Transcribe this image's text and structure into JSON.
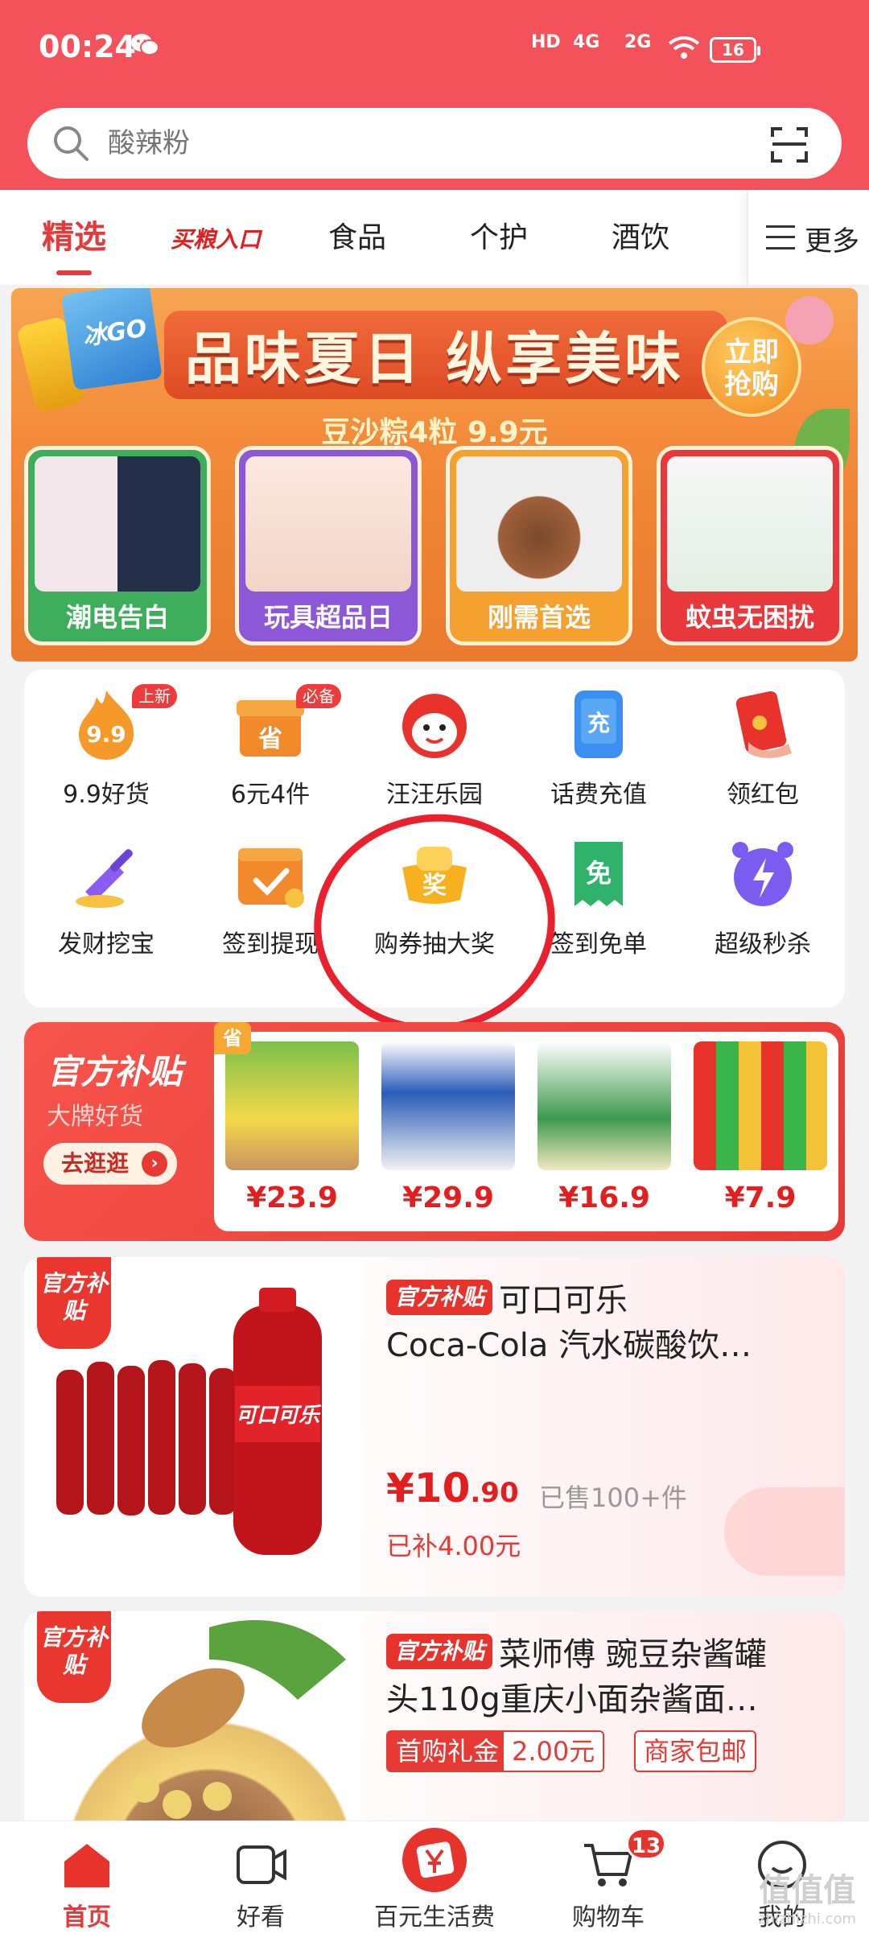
{
  "status_bar": {
    "time": "00:24",
    "hd": "HD",
    "net1": "4G",
    "net2": "2G",
    "battery": "16"
  },
  "search": {
    "placeholder": "酸辣粉"
  },
  "tabs": [
    {
      "label": "精选",
      "active": true
    },
    {
      "label": "买粮入口",
      "special": true
    },
    {
      "label": "食品"
    },
    {
      "label": "个护"
    },
    {
      "label": "酒饮"
    }
  ],
  "more_label": "更多",
  "banner": {
    "headline": "品味夏日 纵享美味",
    "sub": "豆沙粽4粒 9.9元",
    "buy_line1": "立即",
    "buy_line2": "抢购",
    "pkg_text": "冰GO",
    "cards": [
      {
        "label": "潮电告白"
      },
      {
        "label": "玩具超品日"
      },
      {
        "label": "刚需首选"
      },
      {
        "label": "蚊虫无困扰"
      }
    ]
  },
  "grid": {
    "items": [
      {
        "label": "9.9好货",
        "tag": "上新",
        "icon": "flame-99-icon"
      },
      {
        "label": "6元4件",
        "tag": "必备",
        "icon": "save-box-icon"
      },
      {
        "label": "汪汪乐园",
        "icon": "dog-mascot-icon"
      },
      {
        "label": "话费充值",
        "icon": "phone-topup-icon"
      },
      {
        "label": "领红包",
        "icon": "red-envelope-icon"
      },
      {
        "label": "发财挖宝",
        "icon": "shovel-treasure-icon"
      },
      {
        "label": "签到提现",
        "icon": "calendar-check-icon"
      },
      {
        "label": "购券抽大奖",
        "icon": "gold-ingot-prize-icon"
      },
      {
        "label": "签到免单",
        "icon": "free-receipt-icon"
      },
      {
        "label": "超级秒杀",
        "icon": "alarm-bolt-icon"
      }
    ],
    "icon_glyphs": {
      "n99": "9.9",
      "sheng": "省",
      "chong": "充",
      "jiang": "奖",
      "mian": "免"
    }
  },
  "subsidy": {
    "title": "官方补贴",
    "sub": "大牌好货",
    "go": "去逛逛",
    "save_tag": "省",
    "products": [
      {
        "price": "¥23.9"
      },
      {
        "price": "¥29.9"
      },
      {
        "price": "¥16.9"
      },
      {
        "price": "¥7.9"
      }
    ]
  },
  "feed": [
    {
      "corner": "官方补贴",
      "badge": "官方补贴",
      "name_line1": "可口可乐",
      "name_line2": "Coca-Cola 汽水碳酸饮…",
      "price_int": "¥10",
      "price_dec": ".90",
      "sold": "已售100+件",
      "subsidized": "已补4.00元",
      "bottle_label": "可口可乐"
    },
    {
      "corner": "官方补贴",
      "badge": "官方补贴",
      "name_line1": "菜师傅 豌豆杂酱罐",
      "name_line2": "头110g重庆小面杂酱面…",
      "coupon_label": "首购礼金",
      "coupon_value": "2.00元",
      "shipping": "商家包邮"
    }
  ],
  "bottom_nav": [
    {
      "label": "首页",
      "active": true,
      "icon": "home-icon"
    },
    {
      "label": "好看",
      "icon": "video-icon"
    },
    {
      "label": "百元生活费",
      "icon": "gift-coin-icon"
    },
    {
      "label": "购物车",
      "icon": "cart-icon",
      "count": "13"
    },
    {
      "label": "我的",
      "icon": "profile-icon"
    }
  ],
  "watermark": {
    "main": "值值值",
    "domain": "zhizhizhi.com"
  }
}
